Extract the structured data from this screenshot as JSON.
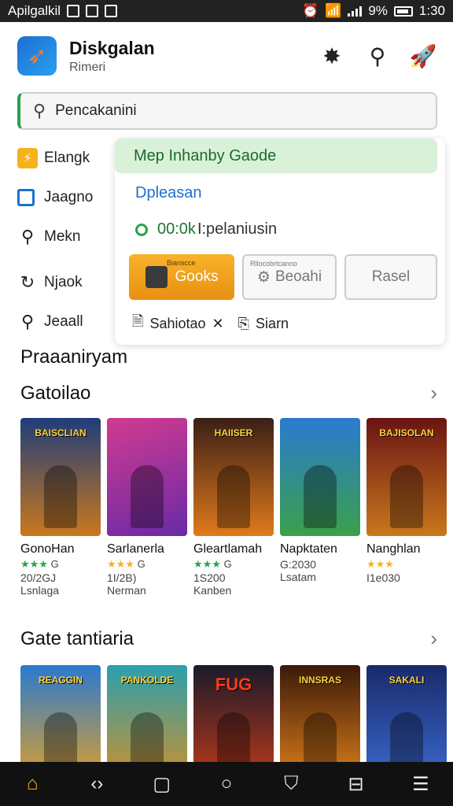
{
  "status_bar": {
    "left_text": "Apilgalkil",
    "right_text": "9%",
    "time": "1:30"
  },
  "header": {
    "title": "Diskgalan",
    "subtitle": "Rimeri"
  },
  "search": {
    "text": "Pencakanini"
  },
  "side_menu": {
    "items": [
      {
        "label": "Elangk",
        "icon": "lightning-icon"
      },
      {
        "label": "Jaagno",
        "icon": "square-icon"
      },
      {
        "label": "Mekn",
        "icon": "search-icon"
      },
      {
        "label": "Njaok",
        "icon": "refresh-icon"
      },
      {
        "label": "Jeaall",
        "icon": "search-icon"
      }
    ]
  },
  "popup": {
    "header": "Mep Inhanby Gaode",
    "subtitle": "Dpleasan",
    "status_value": "00:0k",
    "status_text": "I:pelaniusin",
    "primary_button": {
      "label": "Gooks",
      "small": "Bianscce"
    },
    "secondary_button": {
      "label": "Beoahi",
      "small": "Rllocobrtcanno"
    },
    "reset_button": {
      "label": "Rasel"
    },
    "footer_left": "Sahiotao",
    "footer_right": "Siarn"
  },
  "section_label": "Praaaniryam",
  "sections": [
    {
      "title": "Gatoilao",
      "cards": [
        {
          "name": "GonoHan",
          "stars": "★★★",
          "rating": "G",
          "meta1": "20/2GJ",
          "meta2": "Lsnlaga",
          "cover_title": "BAISCLIAN",
          "bg1": "#1f3d7a",
          "bg2": "#c9781d"
        },
        {
          "name": "Sarlanerla",
          "stars": "★★★",
          "rating": "G",
          "meta1": "1I/2B)",
          "meta2": "Nerman",
          "cover_title": "",
          "bg1": "#d03b8f",
          "bg2": "#6a2aa8"
        },
        {
          "name": "Gleartlamah",
          "stars": "★★★",
          "rating": "G",
          "meta1": "1S200",
          "meta2": "Kanben",
          "cover_title": "HAIISER",
          "bg1": "#3a1f16",
          "bg2": "#e07a1c"
        },
        {
          "name": "Napktaten",
          "stars": "",
          "rating": "",
          "meta1": "G:2030",
          "meta2": "Lsatam",
          "cover_title": "",
          "bg1": "#2b7ad0",
          "bg2": "#3aa04a"
        },
        {
          "name": "Nanghlan",
          "stars": "★★★",
          "rating": "",
          "meta1": "I1e030",
          "meta2": "",
          "cover_title": "BAJISOLAN",
          "bg1": "#6a1414",
          "bg2": "#c9781d"
        }
      ]
    },
    {
      "title": "Gate tantiaria",
      "cards": [
        {
          "name": "",
          "cover_title": "REAGGIN",
          "bg1": "#2a7ad0",
          "bg2": "#e0a02a"
        },
        {
          "name": "",
          "cover_title": "PANKOLDE",
          "bg1": "#2aa0b0",
          "bg2": "#d0902a"
        },
        {
          "name": "",
          "cover_title": "FUG",
          "bg1": "#1a1a2a",
          "bg2": "#c03a1a"
        },
        {
          "name": "",
          "cover_title": "INNSRAS",
          "bg1": "#3a1a0a",
          "bg2": "#e0801a"
        },
        {
          "name": "",
          "cover_title": "SAKALI",
          "bg1": "#1a2a6a",
          "bg2": "#3a6ad0"
        }
      ]
    }
  ],
  "bottom_nav": [
    "home-icon",
    "back-icon",
    "app-icon",
    "circle-icon",
    "shield-icon",
    "book-icon",
    "menu-icon"
  ]
}
